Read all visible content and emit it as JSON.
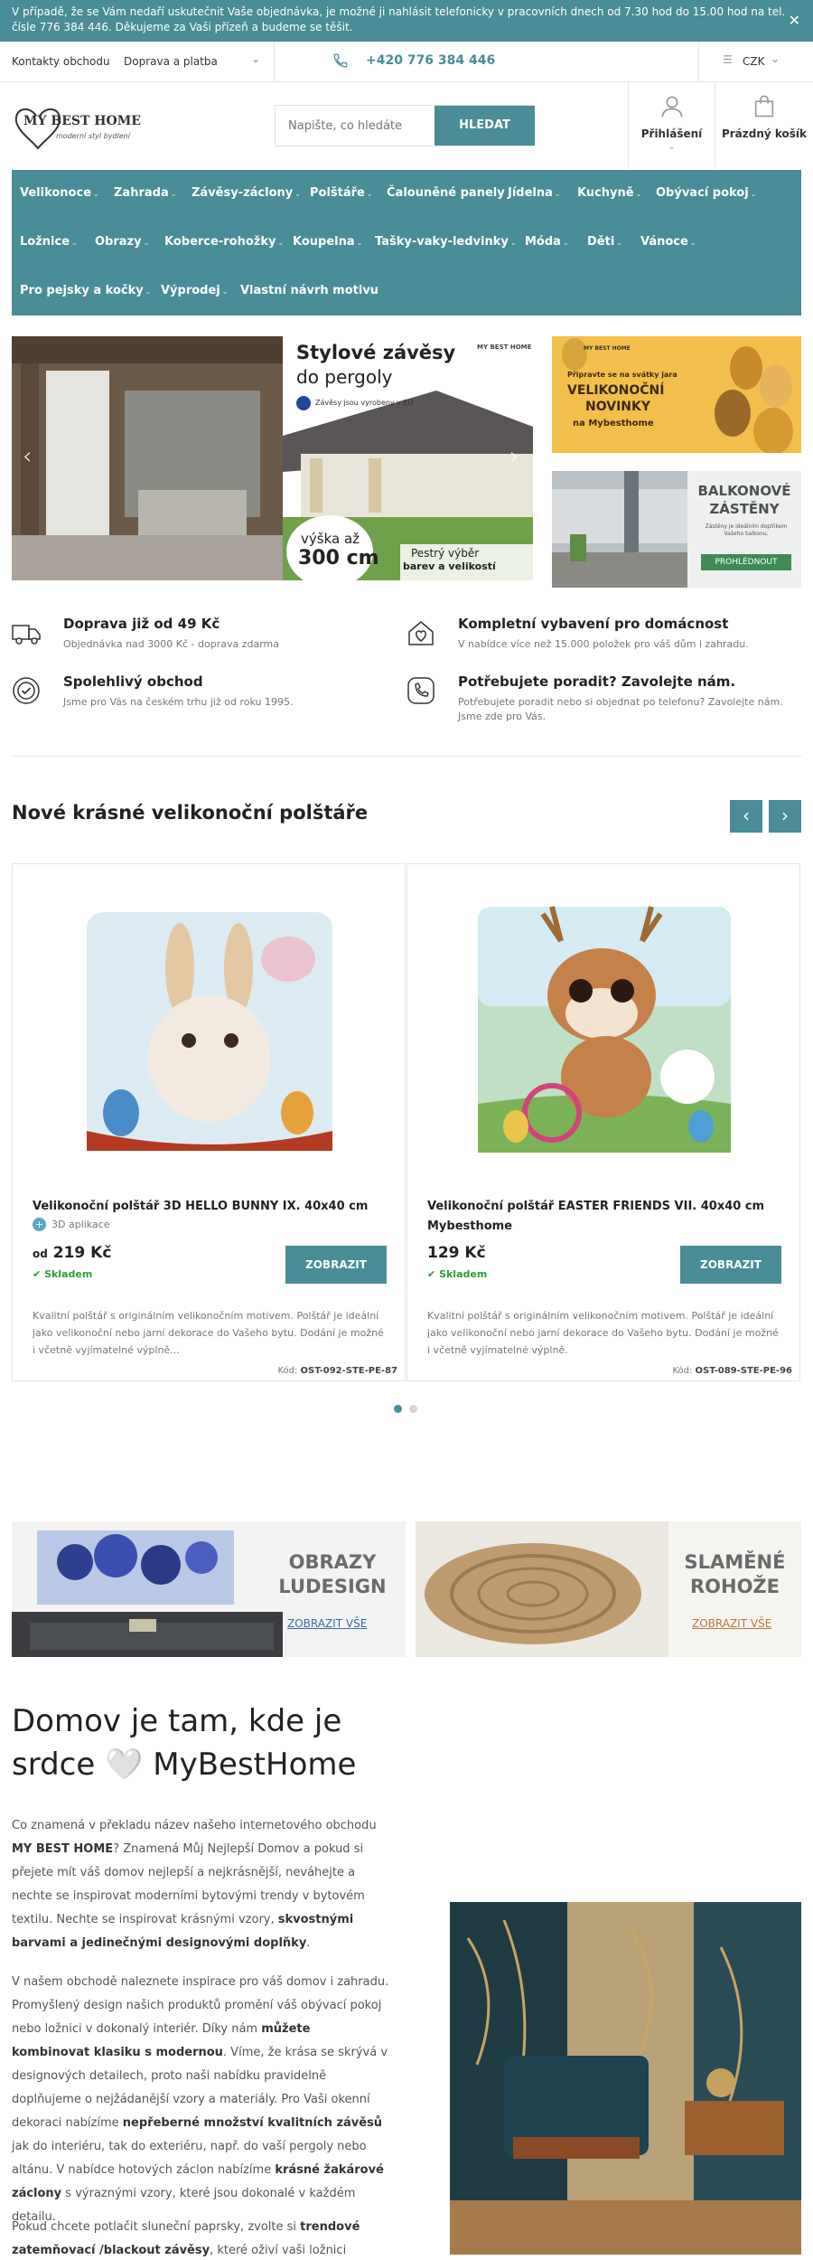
{
  "notice": {
    "text": "V případě, že se Vám nedaří uskutečnit Vaše objednávka, je možné ji nahlásit telefonicky v pracovních dnech od 7.30 hod do 15.00 hod na tel. čísle 776 384 446. Děkujeme za Vaši přízeň a budeme se těšit."
  },
  "topbar": {
    "contacts": "Kontakty obchodu",
    "shipping": "Doprava a platba",
    "phone": "+420 776 384 446",
    "currency": "CZK"
  },
  "header": {
    "logo_text": "MY BEST HOME",
    "logo_tagline": "moderní styl bydlení",
    "search_placeholder": "Napište, co hledáte",
    "search_button": "HLEDAT",
    "login": "Přihlášení",
    "cart": "Prázdný košík"
  },
  "nav": {
    "items": [
      "Velikonoce",
      "Zahrada",
      "Závěsy-záclony",
      "Polštáře",
      "Čalouněné panely",
      "Jídelna",
      "Kuchyně",
      "Obývací pokoj",
      "Ložnice",
      "Obrazy",
      "Koberce-rohožky",
      "Koupelna",
      "Tašky-vaky-ledvinky",
      "Móda",
      "Děti",
      "Vánoce",
      "Pro pejsky a kočky",
      "Výprodej",
      "Vlastní návrh motivu"
    ]
  },
  "slider": {
    "title": "Stylové závěsy",
    "subtitle": "do pergoly",
    "badge": "Závěsy jsou vyrobeny v EU",
    "height_label": "výška až",
    "height_value": "300 cm",
    "choice_label": "Pestrý výběr",
    "choice_label2": "barev a velikostí",
    "brand": "MY BEST HOME"
  },
  "banner1": {
    "pre": "Připravte se na svátky jara",
    "line1": "VELIKONOČNÍ",
    "line2": "NOVINKY",
    "post": "na Mybesthome"
  },
  "banner2": {
    "line1": "BALKONOVÉ",
    "line2": "ZÁSTĚNY",
    "sub": "Zástěny je ideálním doplňkem Vašeho balkonu.",
    "cta": "PROHLÉDNOUT"
  },
  "features": [
    {
      "title": "Doprava již od 49 Kč",
      "desc": "Objednávka nad 3000 Kč - doprava zdarma",
      "icon": "delivery-truck-icon"
    },
    {
      "title": "Kompletní vybavení pro domácnost",
      "desc": "V nabídce více než 15.000 položek pro váš dům i zahradu.",
      "icon": "house-heart-icon"
    },
    {
      "title": "Spolehlivý obchod",
      "desc": "Jsme pro Vás na českém trhu již od roku 1995.",
      "icon": "quality-badge-icon"
    },
    {
      "title": "Potřebujete poradit? Zavolejte nám.",
      "desc": "Potřebujete poradit nebo si objednat po telefonu? Zavolejte nám. Jsme zde pro Vás.",
      "icon": "phone-icon"
    }
  ],
  "products": {
    "section_title": "Nové krásné velikonoční polštáře",
    "items": [
      {
        "name": "Velikonoční polštář 3D HELLO BUNNY IX. 40x40 cm",
        "tag": "3D aplikace",
        "price_prefix": "od",
        "price": "219 Kč",
        "stock": "Skladem",
        "button": "ZOBRAZIT",
        "desc": "Kvalitní polštář s originálním velikonočním motivem. Polštář je ideální jako velikonoční nebo jarní dekorace do Vašeho bytu.  Dodání je možné i včetně vyjímatelné výplně...",
        "code_label": "Kód:",
        "code": "OST-092-STE-PE-87"
      },
      {
        "name": "Velikonoční polštář EASTER FRIENDS VII. 40x40 cm Mybesthome",
        "price": "129 Kč",
        "stock": "Skladem",
        "button": "ZOBRAZIT",
        "desc": "Kvalitní polštář s originálním velikonočním motivem. Polštář je ideální jako velikonoční nebo jarní dekorace do Vašeho bytu.  Dodání je možné i včetně vyjímatelné výplně.",
        "code_label": "Kód:",
        "code": "OST-089-STE-PE-96"
      }
    ]
  },
  "categories": [
    {
      "title1": "OBRAZY",
      "title2": "LUDESIGN",
      "link": "ZOBRAZIT VŠE",
      "link_color": "#3a6ea8"
    },
    {
      "title1": "SLAMĚNÉ",
      "title2": "ROHOŽE",
      "link": "ZOBRAZIT VŠE",
      "link_color": "#b07a3f"
    }
  ],
  "about": {
    "heading_a": "Domov je tam, kde je",
    "heading_b": "srdce",
    "heading_heart": "🤍",
    "heading_c": "MyBestHome",
    "p1": [
      "Co znamená v překladu název našeho internetového obchodu ",
      "MY BEST HOME",
      "? Znamená Můj Nejlepší Domov a pokud si přejete mít váš domov nejlepší a nejkrásnější, neváhejte a nechte se inspirovat moderními bytovými trendy v bytovém textilu. Nechte se inspirovat krásnými vzory, ",
      "skvostnými barvami a jedinečnými designovými doplňky",
      "."
    ],
    "p2": [
      "V našem obchodě naleznete inspirace pro váš domov i zahradu. Promyšlený design našich produktů promění váš obývací pokoj nebo ložnici v dokonalý interiér. Díky nám ",
      "můžete kombinovat klasiku s modernou",
      ". Víme, že krása se skrývá v designových detailech, proto naši nabídku pravidelně doplňujeme o nejžádanější vzory a materiály. Pro Vaši okenní dekoraci nabízíme ",
      "nepřeberné množství kvalitních závěsů",
      " jak do interiéru, tak do exteriéru, např. do vaší pergoly nebo altánu. V nabídce hotových záclon nabízíme ",
      "krásné žakárové záclony",
      " s výraznými vzory, které jsou dokonalé v každém detailu."
    ],
    "p3": [
      "Pokud chcete potlačit sluneční paprsky, zvolte si ",
      "trendové zatemňovací /blackout závěsy",
      ", které oživí vaši ložnici různými"
    ]
  },
  "colors": {
    "accent": "#4a8c97",
    "stock": "#2f9b39"
  }
}
